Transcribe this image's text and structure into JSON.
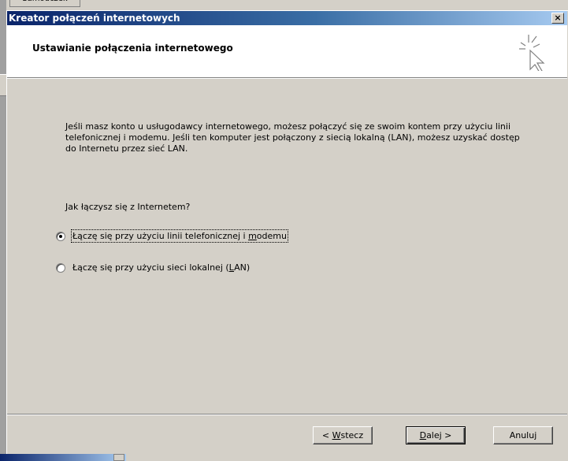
{
  "background": {
    "tab_label": "Samouczek"
  },
  "window": {
    "title": "Kreator połączeń internetowych",
    "close_label": "×"
  },
  "header": {
    "title": "Ustawianie połączenia internetowego",
    "icon": "wizard-cursor-icon"
  },
  "content": {
    "description": "Jeśli masz konto u usługodawcy internetowego, możesz połączyć się ze swoim kontem przy użyciu linii telefonicznej i modemu. Jeśli ten komputer jest połączony z siecią lokalną (LAN), możesz uzyskać dostęp do Internetu przez sieć LAN.",
    "question": "Jak łączysz się z Internetem?",
    "options": [
      {
        "label_pre": "Łączę się przy użyciu linii telefonicznej i ",
        "label_accel": "m",
        "label_post": "odemu",
        "selected": true
      },
      {
        "label_pre": "Łączę się przy użyciu sieci lokalnej (",
        "label_accel": "L",
        "label_post": "AN)",
        "selected": false
      }
    ]
  },
  "buttons": {
    "back_pre": "< ",
    "back_accel": "W",
    "back_post": "stecz",
    "next_accel": "D",
    "next_post": "alej >",
    "cancel": "Anuluj"
  }
}
